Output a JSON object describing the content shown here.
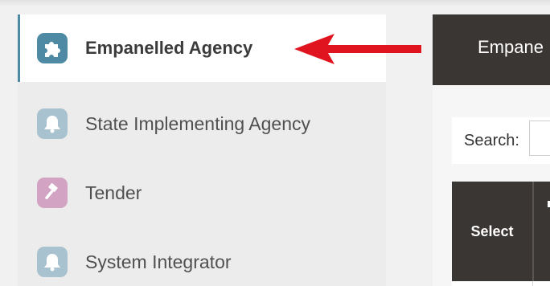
{
  "sidebar": {
    "items": [
      {
        "label": "Empanelled Agency",
        "icon": "puzzle-icon",
        "active": true,
        "color": "#4e8aa3"
      },
      {
        "label": "State Implementing Agency",
        "icon": "bell-icon",
        "active": false,
        "color": "#a9c2cf"
      },
      {
        "label": "Tender",
        "icon": "gavel-icon",
        "active": false,
        "color": "#d3a3c3"
      },
      {
        "label": "System Integrator",
        "icon": "bell-icon",
        "active": false,
        "color": "#a9c2cf"
      }
    ]
  },
  "annotation": {
    "arrow_color": "#e0141e"
  },
  "content": {
    "header_title": "Empane",
    "search_label": "Search:",
    "search_value": "",
    "table": {
      "columns": [
        "Select"
      ]
    }
  },
  "colors": {
    "header_bg": "#3a3634",
    "active_border": "#4e8aa3"
  }
}
